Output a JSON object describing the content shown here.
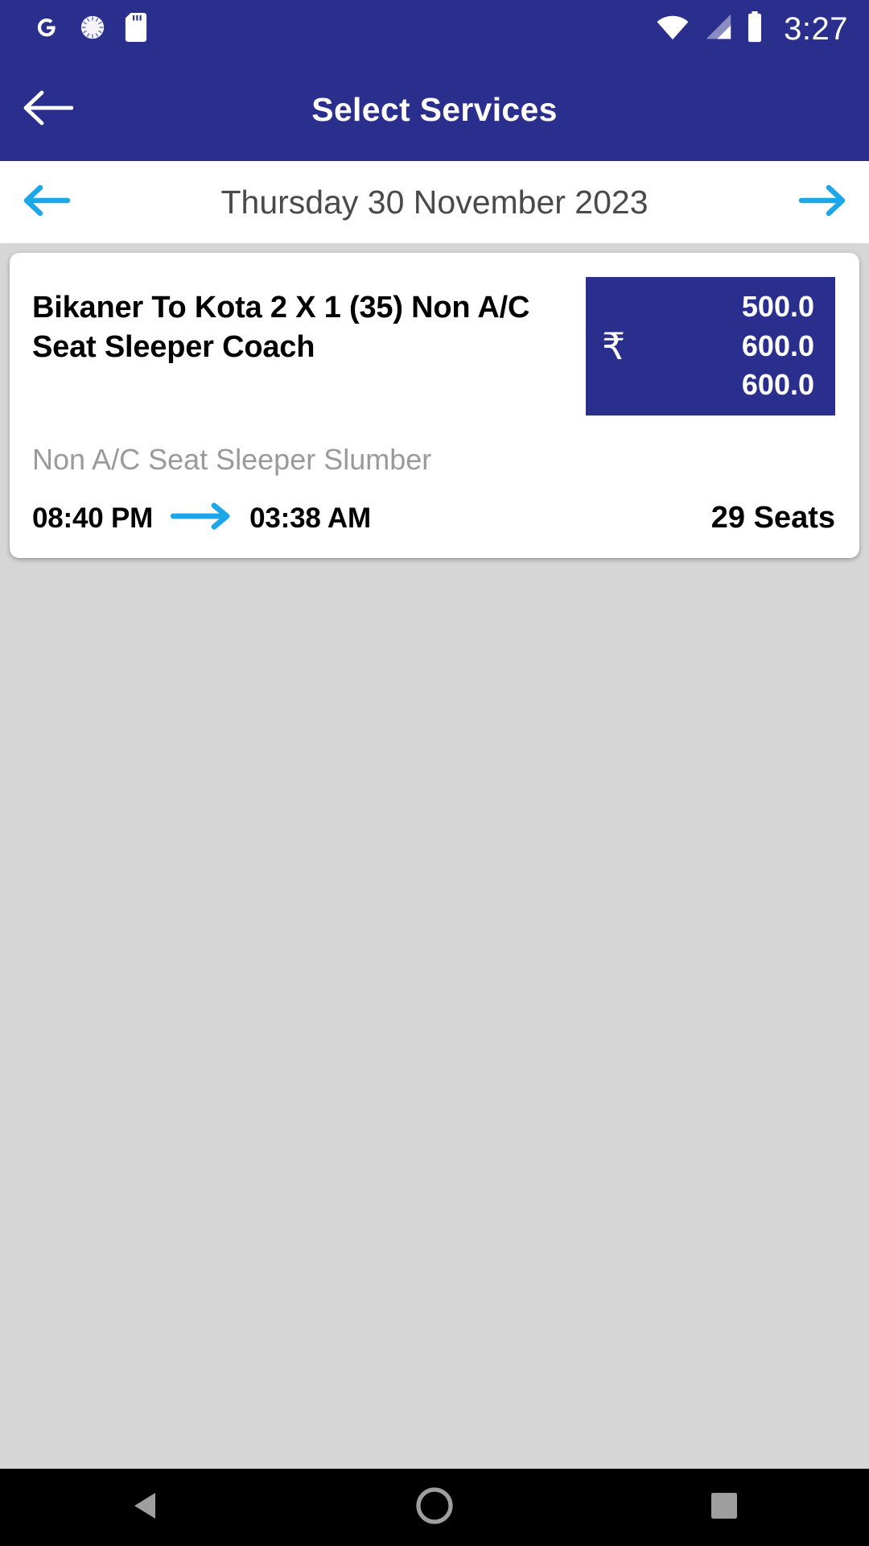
{
  "status_bar": {
    "icons": [
      "google-icon",
      "sync-spinner-icon",
      "sd-card-icon",
      "wifi-icon",
      "signal-icon",
      "battery-icon"
    ],
    "time": "3:27"
  },
  "app_bar": {
    "back_icon": "back-arrow-icon",
    "title": "Select Services"
  },
  "date_bar": {
    "prev_icon": "arrow-left-icon",
    "date": "Thursday 30 November 2023",
    "next_icon": "arrow-right-icon"
  },
  "service_card": {
    "title": "Bikaner To Kota 2 X 1 (35) Non A/C Seat Sleeper Coach",
    "subtitle": "Non A/C Seat Sleeper Slumber",
    "currency_symbol": "₹",
    "fares": [
      "500.0",
      "600.0",
      "600.0"
    ],
    "departure_time": "08:40 PM",
    "arrival_time": "03:38 AM",
    "route_arrow_icon": "arrow-right-icon",
    "seats_available": "29 Seats"
  },
  "nav_bar": {
    "back_label": "back-triangle-icon",
    "home_label": "home-circle-icon",
    "recents_label": "recents-square-icon"
  },
  "colors": {
    "primary_blue": "#2a2e8c",
    "accent_cyan": "#1ba7e8",
    "page_background": "#d6d6d6",
    "card_background": "#ffffff",
    "muted_text": "#9a9a9a"
  }
}
